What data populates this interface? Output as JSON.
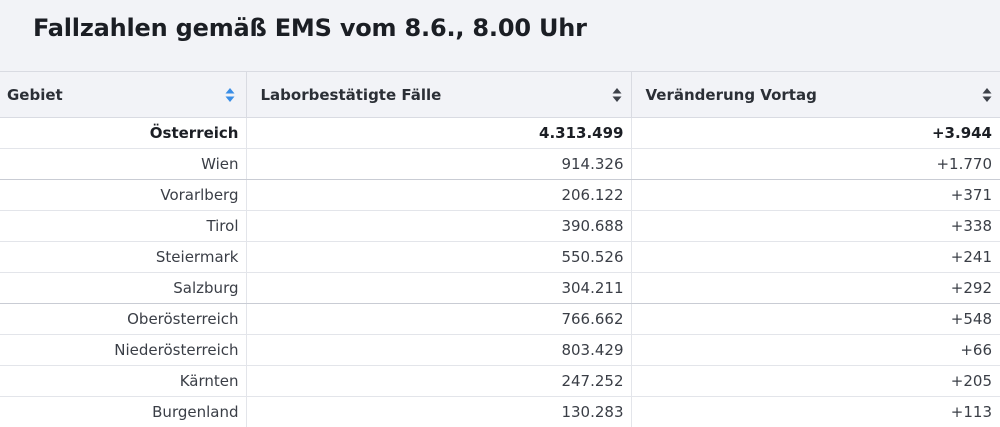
{
  "title": "Fallzahlen gemäß EMS vom 8.6., 8.00 Uhr",
  "columns": [
    "Gebiet",
    "Laborbestätigte Fälle",
    "Veränderung Vortag"
  ],
  "accent_color": "#3a8ee6",
  "rows": [
    [
      "Österreich",
      "4.313.499",
      "+3.944"
    ],
    [
      "Wien",
      "914.326",
      "+1.770"
    ],
    [
      "Vorarlberg",
      "206.122",
      "+371"
    ],
    [
      "Tirol",
      "390.688",
      "+338"
    ],
    [
      "Steiermark",
      "550.526",
      "+241"
    ],
    [
      "Salzburg",
      "304.211",
      "+292"
    ],
    [
      "Oberösterreich",
      "766.662",
      "+548"
    ],
    [
      "Niederösterreich",
      "803.429",
      "+66"
    ],
    [
      "Kärnten",
      "247.252",
      "+205"
    ],
    [
      "Burgenland",
      "130.283",
      "+113"
    ]
  ]
}
